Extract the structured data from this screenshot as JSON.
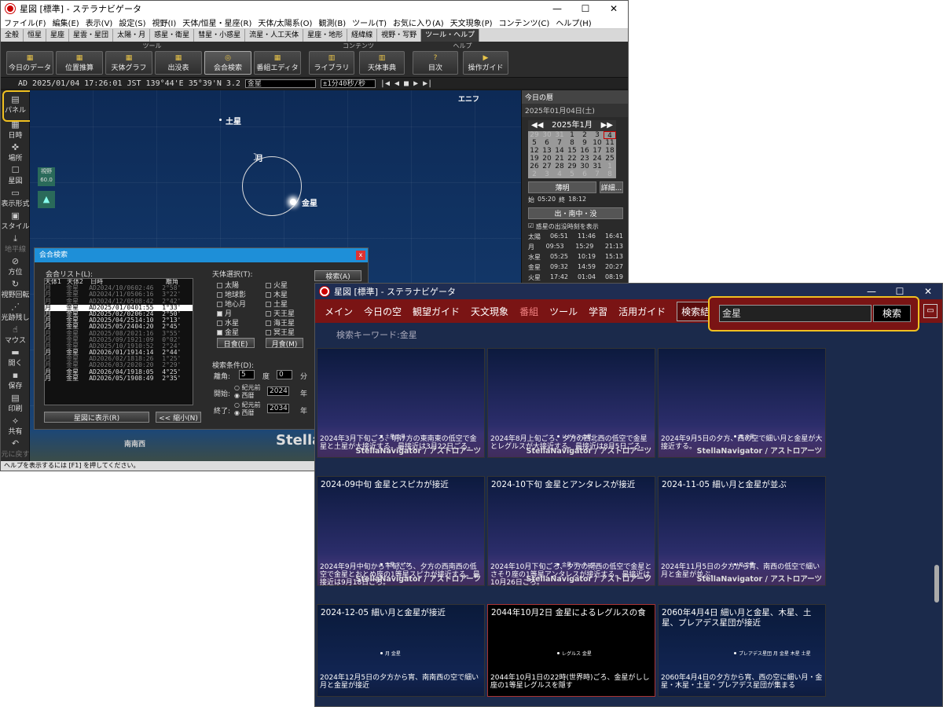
{
  "win1": {
    "title": "星図 [標準] - ステラナビゲータ",
    "menu": [
      "ファイル(F)",
      "編集(E)",
      "表示(V)",
      "設定(S)",
      "視野(I)",
      "天体/恒星・星座(R)",
      "天体/太陽系(O)",
      "観測(B)",
      "ツール(T)",
      "お気に入り(A)",
      "天文現象(P)",
      "コンテンツ(C)",
      "ヘルプ(H)"
    ],
    "tabs": [
      "全般",
      "恒星",
      "星座",
      "星雲・星団",
      "太陽・月",
      "惑星・衛星",
      "彗星・小惑星",
      "流星・人工天体",
      "星座・地形",
      "経緯線",
      "視野・写野",
      "ツール・ヘルプ"
    ],
    "ribbon": {
      "group_tool": "ツール",
      "group_contents": "コンテンツ",
      "group_help": "ヘルプ",
      "buttons": [
        "今日のデータ",
        "位置推算",
        "天体グラフ",
        "出没表",
        "会合検索",
        "番組エディタ",
        "ライブラリ",
        "天体事典",
        "目次",
        "操作ガイド"
      ]
    },
    "status": {
      "era": "AD",
      "datetime": "2025/01/04 17:26:01 JST",
      "lon": "139°44'E",
      "lat": "35°39'N",
      "fov": "3.2",
      "target": "金星",
      "speed": "±1分40秒/秒"
    },
    "leftbar": [
      "パネル",
      "日時",
      "場所",
      "星図",
      "表示形式",
      "スタイル",
      "地平線",
      "方位",
      "視野回転",
      "光跡残し",
      "マウス",
      "開く",
      "保存",
      "印刷",
      "共有",
      "元に戻す"
    ],
    "sky": {
      "saturn": "土星",
      "moon": "月",
      "venus": "金星",
      "direction": "エニフ",
      "fov_badge": "視野",
      "fov_value": "60.0",
      "horizon_label": "南南西",
      "watermark": "Stella"
    },
    "panel": {
      "title": "今日の暦",
      "date": "2025年01月04日(土)",
      "month": "2025年1月",
      "weekdays": [
        "29",
        "30",
        "31",
        "1",
        "2",
        "3",
        "4",
        "5",
        "6",
        "7",
        "8",
        "9",
        "10",
        "11",
        "12",
        "13",
        "14",
        "15",
        "16",
        "17",
        "18",
        "19",
        "20",
        "21",
        "22",
        "23",
        "24",
        "25",
        "26",
        "27",
        "28",
        "29",
        "30",
        "31",
        "1",
        "2",
        "3",
        "4",
        "5",
        "6",
        "7",
        "8"
      ],
      "twilight": "薄明",
      "twilight_start_label": "始",
      "twilight_start": "05:20",
      "twilight_end_label": "終",
      "twilight_end": "18:12",
      "detail_btn": "詳細...",
      "rise_set_title": "出・南中・没",
      "rise_set_check": "惑星の出没時刻を表示",
      "rows": [
        [
          "太陽",
          "06:51",
          "11:46",
          "16:41"
        ],
        [
          "月",
          "09:53",
          "15:29",
          "21:13"
        ],
        [
          "水星",
          "05:25",
          "10:19",
          "15:13"
        ],
        [
          "金星",
          "09:32",
          "14:59",
          "20:27"
        ],
        [
          "火星",
          "17:42",
          "01:04",
          "08:19"
        ],
        [
          "木星",
          "14:21",
          "21:30",
          "04:42"
        ],
        [
          "土星",
          "10:12",
          "15:51",
          "21:31"
        ]
      ]
    },
    "dialog": {
      "title": "会合検索",
      "list_label": "会合リスト(L):",
      "col1": "天体1",
      "col2": "天体2",
      "col3": "日時",
      "col4": "離角",
      "rows": [
        [
          "月",
          "金星",
          "AD2024/10/06",
          "02:46",
          "2°58'"
        ],
        [
          "月",
          "金星",
          "AD2024/11/05",
          "06:16",
          "3°22'"
        ],
        [
          "月",
          "金星",
          "AD2024/12/05",
          "08:42",
          "2°42'"
        ],
        [
          "月",
          "金星",
          "AD2025/01/04",
          "01:55",
          "1°33'"
        ],
        [
          "月",
          "金星",
          "AD2025/02/02",
          "06:24",
          "2°50'"
        ],
        [
          "月",
          "金星",
          "AD2025/04/25",
          "14:10",
          "2°13'"
        ],
        [
          "月",
          "金星",
          "AD2025/05/24",
          "04:20",
          "2°45'"
        ],
        [
          "月",
          "金星",
          "AD2025/08/20",
          "21:16",
          "3°55'"
        ],
        [
          "月",
          "金星",
          "AD2025/09/19",
          "21:09",
          "0°02'"
        ],
        [
          "月",
          "金星",
          "AD2025/10/19",
          "10:52",
          "2°24'"
        ],
        [
          "月",
          "金星",
          "AD2026/01/19",
          "14:14",
          "2°44'"
        ],
        [
          "月",
          "金星",
          "AD2026/02/18",
          "18:26",
          "1°25'"
        ],
        [
          "月",
          "金星",
          "AD2026/03/20",
          "20:20",
          "2°29'"
        ],
        [
          "月",
          "金星",
          "AD2026/04/19",
          "18:05",
          "4°25'"
        ],
        [
          "月",
          "金星",
          "AD2026/05/19",
          "08:49",
          "2°35'"
        ]
      ],
      "show_btn": "星図に表示(R)",
      "shrink_btn": "<< 縮小(N)",
      "select_label": "天体選択(T):",
      "search_btn": "検索(A)",
      "objects_left": [
        "太陽",
        "地球影",
        "地心月",
        "月",
        "水星",
        "金星"
      ],
      "objects_right": [
        "火星",
        "木星",
        "土星",
        "天王星",
        "海王星",
        "冥王星"
      ],
      "solar_eclipse": "日食(E)",
      "lunar_eclipse": "月食(M)",
      "conditions_label": "検索条件(D):",
      "sep_label": "離角:",
      "sep_deg": "5",
      "deg_unit": "度",
      "sep_min": "0",
      "min_unit": "分",
      "start_label": "開始:",
      "end_label": "終了:",
      "bc": "紀元前",
      "ad": "西暦",
      "start_year": "2024",
      "end_year": "2034",
      "year_unit": "年"
    },
    "status_bar": "ヘルプを表示するには [F1] を押してください。"
  },
  "win2": {
    "title": "星図 [標準] - ステラナビゲータ",
    "nav": [
      "メイン",
      "今日の空",
      "観望ガイド",
      "天文現象",
      "番組",
      "ツール",
      "学習",
      "活用ガイド",
      "検索結果"
    ],
    "search_value": "金星",
    "search_btn": "検索",
    "keyword": "検索キーワード:金星",
    "tiles": [
      {
        "title": "",
        "caption": "2024年3月下旬ごろ、明け方の東南東の低空で金星と土星が大接近する。最接近は3月22日ごろ。",
        "credit": "StellaNavigator / アストロアーツ"
      },
      {
        "title": "",
        "caption": "2024年8月上旬ごろ、夕方の西北西の低空で金星とレグルスが大接近する。最接近は8月5日ごろ。",
        "credit": "StellaNavigator / アストロアーツ"
      },
      {
        "title": "",
        "caption": "2024年9月5日の夕方、西の空で細い月と金星が大接近する。",
        "credit": "StellaNavigator / アストロアーツ"
      },
      {
        "title": "2024-09中旬 金星とスピカが接近",
        "caption": "2024年9月中旬から下旬ごろ、夕方の西南西の低空で金星とおとめ座の1等星スピカが接近する。最接近は9月18日ごろ。",
        "credit": "StellaNavigator / アストロアーツ"
      },
      {
        "title": "2024-10下旬 金星とアンタレスが接近",
        "caption": "2024年10月下旬ごろ、夕方の南西の低空で金星とさそり座の1等星アンタレスが接近する。最接近は10月26日ごろ。",
        "credit": "StellaNavigator / アストロアーツ"
      },
      {
        "title": "2024-11-05 細い月と金星が並ぶ",
        "caption": "2024年11月5日の夕方から宵、南西の低空で細い月と金星が並ぶ。",
        "credit": "StellaNavigator / アストロアーツ"
      },
      {
        "title": "2024-12-05 細い月と金星が接近",
        "caption": "2024年12月5日の夕方から宵、南南西の空で細い月と金星が接近",
        "credit": ""
      },
      {
        "title": "2044年10月2日 金星によるレグルスの食",
        "caption": "2044年10月1日の22時(世界時)ごろ、金星がしし座の1等星レグルスを隠す",
        "credit": ""
      },
      {
        "title": "2060年4月4日 細い月と金星、木星、土星、プレアデス星団が接近",
        "caption": "2060年4月4日の夕方から宵、西の空に細い月・金星・木星・土星・プレアデス星団が集まる",
        "credit": ""
      }
    ],
    "tile_labels": [
      "土星 金星",
      "レグルス 金星",
      "月 金星",
      "金星 スピカ",
      "金星 アンタレス",
      "月 金星",
      "月 金星",
      "レグルス 金星",
      "プレアデス星団 月 金星 木星 土星"
    ]
  }
}
